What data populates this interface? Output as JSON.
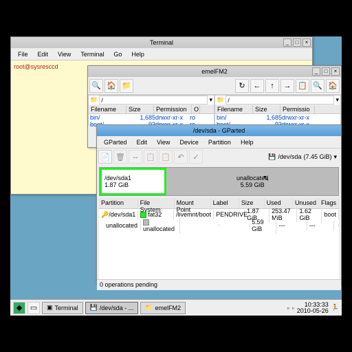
{
  "terminal": {
    "title": "Terminal",
    "menu": [
      "File",
      "Edit",
      "View",
      "Terminal",
      "Go",
      "Help"
    ],
    "prompt": "root@sysresccd"
  },
  "filemanager": {
    "title": "emelFM2",
    "left": {
      "path": "/",
      "headers": [
        "Filename",
        "Size",
        "Permission",
        "O"
      ],
      "rows": [
        {
          "name": "bin/",
          "size": "1,685",
          "perm": "drwxr-xr-x",
          "o": "ro"
        },
        {
          "name": "boot/",
          "size": "93",
          "perm": "drwxr-xr-x",
          "o": "ro"
        }
      ]
    },
    "right": {
      "path": "/",
      "headers": [
        "Filename",
        "Size",
        "Permissio"
      ],
      "rows": [
        {
          "name": "bin/",
          "size": "1,685",
          "perm": "drwxr-xr-x"
        },
        {
          "name": "boot/",
          "size": "93",
          "perm": "drwxr-xr-x"
        }
      ]
    }
  },
  "gparted": {
    "title": "/dev/sda - GParted",
    "menu": [
      "GParted",
      "Edit",
      "View",
      "Device",
      "Partition",
      "Help"
    ],
    "device": "/dev/sda",
    "device_size": "(7.45 GiB)",
    "diagram": {
      "sda1": {
        "name": "/dev/sda1",
        "size": "1.87 GiB"
      },
      "unalloc": {
        "name": "unallocated",
        "size": "5.59 GiB"
      }
    },
    "table": {
      "headers": [
        "Partition",
        "File System",
        "Mount Point",
        "Label",
        "Size",
        "Used",
        "Unused",
        "Flags"
      ],
      "rows": [
        {
          "partition": "/dev/sda1",
          "fs": "fat32",
          "mount": "/livemnt/boot",
          "label": "PENDRIVE",
          "size": "1.87 GiB",
          "used": "253.47 MiB",
          "unused": "1.62 GiB",
          "flags": "boot"
        },
        {
          "partition": "unallocated",
          "fs": "unallocated",
          "mount": "",
          "label": "",
          "size": "5.59 GiB",
          "used": "---",
          "unused": "---",
          "flags": ""
        }
      ]
    },
    "status": "0 operations pending"
  },
  "taskbar": {
    "items": [
      "Terminal",
      "/dev/sda - ...",
      "emelFM2"
    ],
    "time": "10:33:33",
    "date": "2010-05-26"
  }
}
